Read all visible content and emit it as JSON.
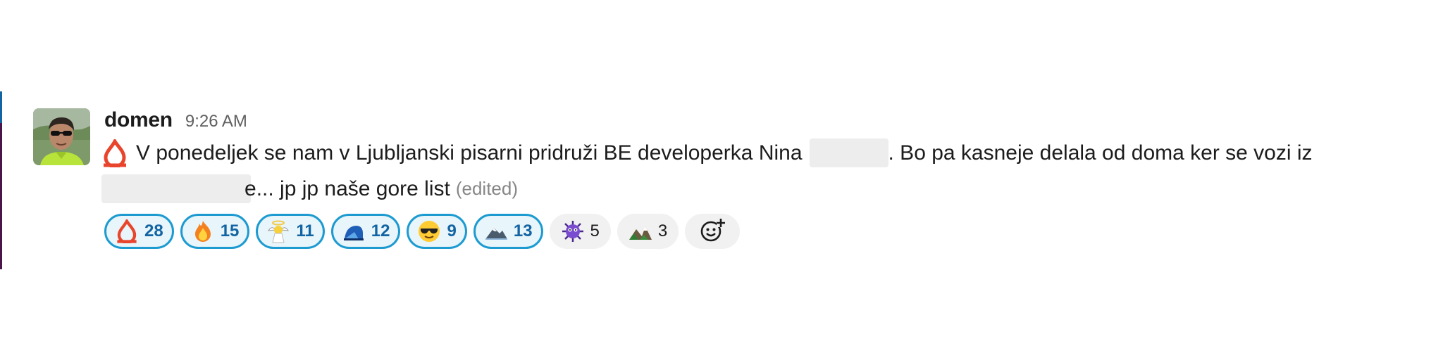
{
  "message": {
    "author": "domen",
    "time": "9:26 AM",
    "line1_part1": "V ponedeljek se nam v Ljubljanski pisarni pridruži BE developerka Nina",
    "line1_part2": ". Bo pa kasneje delala od doma ker se vozi iz",
    "line2_fragment": "e",
    "line2_text": "... jp jp naše gore list",
    "edited": "(edited)"
  },
  "reactions": [
    {
      "icon": "flame-logo-emoji",
      "count": "28",
      "active": true
    },
    {
      "icon": "fire-emoji",
      "count": "15",
      "active": true
    },
    {
      "icon": "angel-homer-emoji",
      "count": "11",
      "active": true
    },
    {
      "icon": "blue-logo-emoji",
      "count": "12",
      "active": true
    },
    {
      "icon": "sunglasses-emoji",
      "count": "9",
      "active": true
    },
    {
      "icon": "snow-mountain-emoji",
      "count": "13",
      "active": true
    },
    {
      "icon": "virus-emoji",
      "count": "5",
      "active": false
    },
    {
      "icon": "mountains-emoji",
      "count": "3",
      "active": false
    }
  ],
  "add_reaction": {
    "icon": "add-reaction-icon"
  },
  "colors": {
    "accent_blue": "#1d9bd1",
    "count_blue": "#1264a3",
    "flame_red": "#e8452c"
  }
}
